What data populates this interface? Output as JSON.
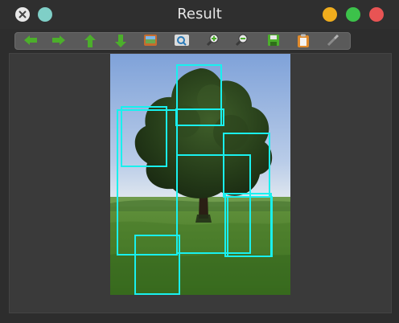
{
  "window": {
    "title": "Result"
  },
  "toolbar": {
    "buttons": [
      {
        "icon": "arrow-left-icon"
      },
      {
        "icon": "arrow-right-icon"
      },
      {
        "icon": "arrow-up-icon"
      },
      {
        "icon": "arrow-down-icon"
      },
      {
        "icon": "image-icon"
      },
      {
        "icon": "zoom-fit-icon"
      },
      {
        "icon": "zoom-in-icon"
      },
      {
        "icon": "zoom-out-icon"
      },
      {
        "icon": "save-icon"
      },
      {
        "icon": "copy-icon"
      },
      {
        "icon": "settings-icon"
      }
    ]
  },
  "colors": {
    "box": "#19f0ee",
    "toolbar_green": "#4caf2b",
    "sky": "#8fb3e6",
    "grass": "#4f8a2a",
    "tree": "#2a3f1c"
  }
}
